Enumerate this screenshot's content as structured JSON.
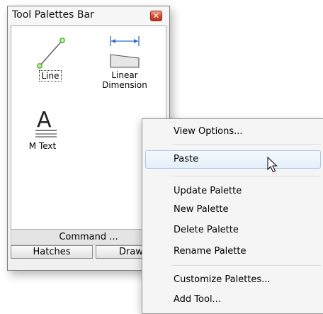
{
  "palette": {
    "title": "Tool Palettes Bar",
    "tools": [
      {
        "label": "Line",
        "icon": "line-tool-icon"
      },
      {
        "label_line1": "Linear",
        "label_line2": "Dimension",
        "icon": "linear-dimension-icon"
      },
      {
        "label": "M Text",
        "icon": "mtext-icon"
      }
    ],
    "command_label": "Command ...",
    "tabs": [
      "Hatches",
      "Draw"
    ]
  },
  "context_menu": {
    "items": [
      {
        "label": "View Options..."
      },
      {
        "label": "Paste",
        "highlighted": true
      },
      {
        "label": "Update Palette"
      },
      {
        "label": "New Palette"
      },
      {
        "label": "Delete Palette"
      },
      {
        "label": "Rename Palette"
      },
      {
        "label": "Customize Palettes..."
      },
      {
        "label": "Add Tool..."
      }
    ]
  },
  "colors": {
    "close_button": "#d24a2d",
    "hover_border": "#a9c7ec",
    "dimension_blue": "#2f6fc9",
    "line_green": "#4caf2a"
  }
}
